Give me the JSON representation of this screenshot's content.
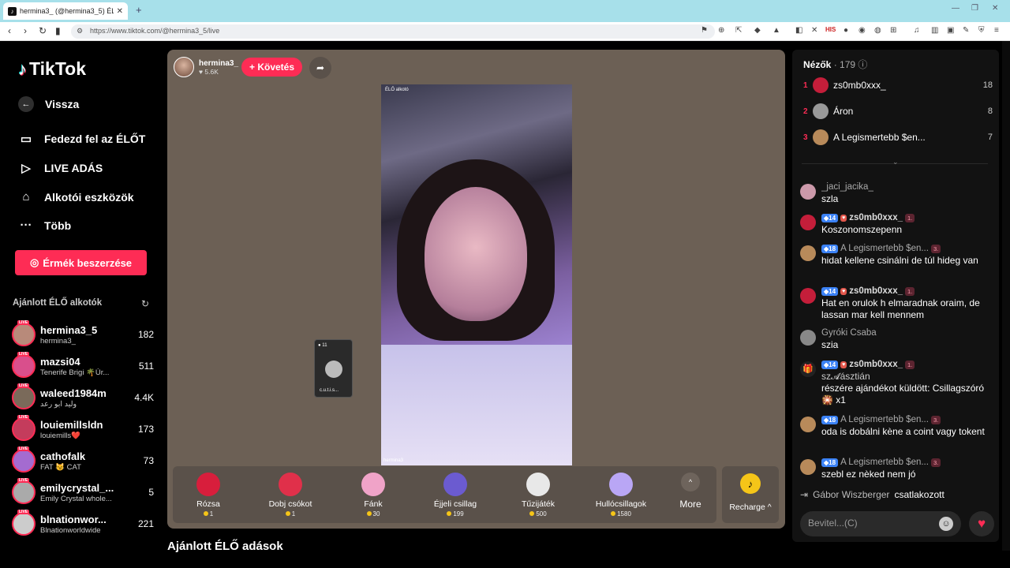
{
  "browser": {
    "tab_title": "hermina3_ (@hermina3_5) ÉL",
    "url": "https://www.tiktok.com/@hermina3_5/live",
    "new_tab": "+",
    "ext_his": "HIS"
  },
  "sidebar": {
    "logo": "TikTok",
    "back": "Vissza",
    "nav": [
      {
        "label": "Fedezd fel az ÉLŐT",
        "icon": "tv-icon"
      },
      {
        "label": "LIVE ADÁS",
        "icon": "camera-icon"
      },
      {
        "label": "Alkotói eszközök",
        "icon": "creator-tools-icon"
      },
      {
        "label": "Több",
        "icon": "more-dots-icon"
      }
    ],
    "coins_button": "Érmék beszerzése",
    "section_title": "Ajánlott ÉLŐ alkotók",
    "live_badge": "LIVE",
    "creators": [
      {
        "name": "hermina3_5",
        "sub": "hermina3_",
        "count": "182",
        "color": "#b88a7a"
      },
      {
        "name": "mazsi04",
        "sub": "Tenerife Brigi 🌴Úr...",
        "count": "511",
        "color": "#d94f8c"
      },
      {
        "name": "waleed1984m",
        "sub": "وليد ابو رعد",
        "count": "4.4K",
        "color": "#7a6a5a"
      },
      {
        "name": "louiemillsldn",
        "sub": "louiemills❤️",
        "count": "173",
        "color": "#c43c5c"
      },
      {
        "name": "cathofalk",
        "sub": "FAT 😼 CAT",
        "count": "73",
        "color": "#a46bd0"
      },
      {
        "name": "emilycrystal_...",
        "sub": "Emily Crystal whole...",
        "count": "5",
        "color": "#aaa"
      },
      {
        "name": "blnationwor...",
        "sub": "Blnationworldwide",
        "count": "221",
        "color": "#ccc"
      }
    ]
  },
  "stage": {
    "host_name": "hermina3_",
    "host_likes": "♥ 5.6K",
    "follow": "+ Követés",
    "video_tag": "ÉLŐ alkotó",
    "video_user": "hermina3",
    "pip_viewers": "11",
    "pip_name": "c.u.t.i.s...",
    "gifts": [
      {
        "name": "Rózsa",
        "price": "1",
        "color": "#d81e3c"
      },
      {
        "name": "Dobj csókot",
        "price": "1",
        "color": "#e0304a"
      },
      {
        "name": "Fánk",
        "price": "30",
        "color": "#f0a3c8"
      },
      {
        "name": "Éjjeli csillag",
        "price": "199",
        "color": "#6b5bd0"
      },
      {
        "name": "Tűzijáték",
        "price": "500",
        "color": "#e8e8e8"
      },
      {
        "name": "Hullócsillagok",
        "price": "1580",
        "color": "#b9a6f5"
      }
    ],
    "more": "More",
    "recharge": "Recharge ^",
    "below_title": "Ajánlott ÉLŐ adások"
  },
  "chat": {
    "header": "Nézők",
    "viewer_count": "· 179",
    "viewers": [
      {
        "rank": "1",
        "name": "zs0mb0xxx_",
        "score": "18",
        "color": "#c41e3a"
      },
      {
        "rank": "2",
        "name": "Áron",
        "score": "8",
        "color": "#999"
      },
      {
        "rank": "3",
        "name": "A Legismertebb $en...",
        "score": "7",
        "color": "#b88a5a"
      }
    ],
    "messages": [
      {
        "user": "_jaci_jacika_",
        "lv": "",
        "rk": "",
        "text": "szla",
        "color": "#c9a"
      },
      {
        "user": "zs0mb0xxx_",
        "lv": "14",
        "rk": "1.",
        "text": "Koszonomszepenn",
        "color": "#c41e3a"
      },
      {
        "user": "A Legismertebb $en...",
        "lv": "18",
        "rk": "3.",
        "text": "hidat kellene csinálni de túl hideg van",
        "color": "#b88a5a"
      },
      {
        "user": "zs0mb0xxx_",
        "lv": "14",
        "rk": "1.",
        "text": "Hat en orulok h elmaradnak oraim, de lassan mar kell mennem",
        "color": "#c41e3a"
      },
      {
        "user": "Gyróki Csaba",
        "lv": "",
        "rk": "",
        "text": "szia",
        "color": "#888"
      },
      {
        "user": "zs0mb0xxx_",
        "lv": "14",
        "rk": "1.",
        "text": "részére ajándékot küldött: Csillagszóró 🎇 x1",
        "color": "#222"
      },
      {
        "user": "A Legismertebb $en...",
        "lv": "18",
        "rk": "3.",
        "text": "oda is dobálni kène a coint vagy tokent",
        "color": "#b88a5a"
      },
      {
        "user": "A Legismertebb $en...",
        "lv": "18",
        "rk": "3.",
        "text": "szebl ez nèked nem jó",
        "color": "#b88a5a"
      }
    ],
    "gift_recipient": "sz𝓐ásztián",
    "joined_user": "Gábor Wiszberger",
    "joined_text": "csatlakozott",
    "input_placeholder": "Bevitel...(C)"
  },
  "colors": {
    "accent": "#fe2c55",
    "stage_bg": "#6c6055",
    "chat_bg": "#121212"
  }
}
